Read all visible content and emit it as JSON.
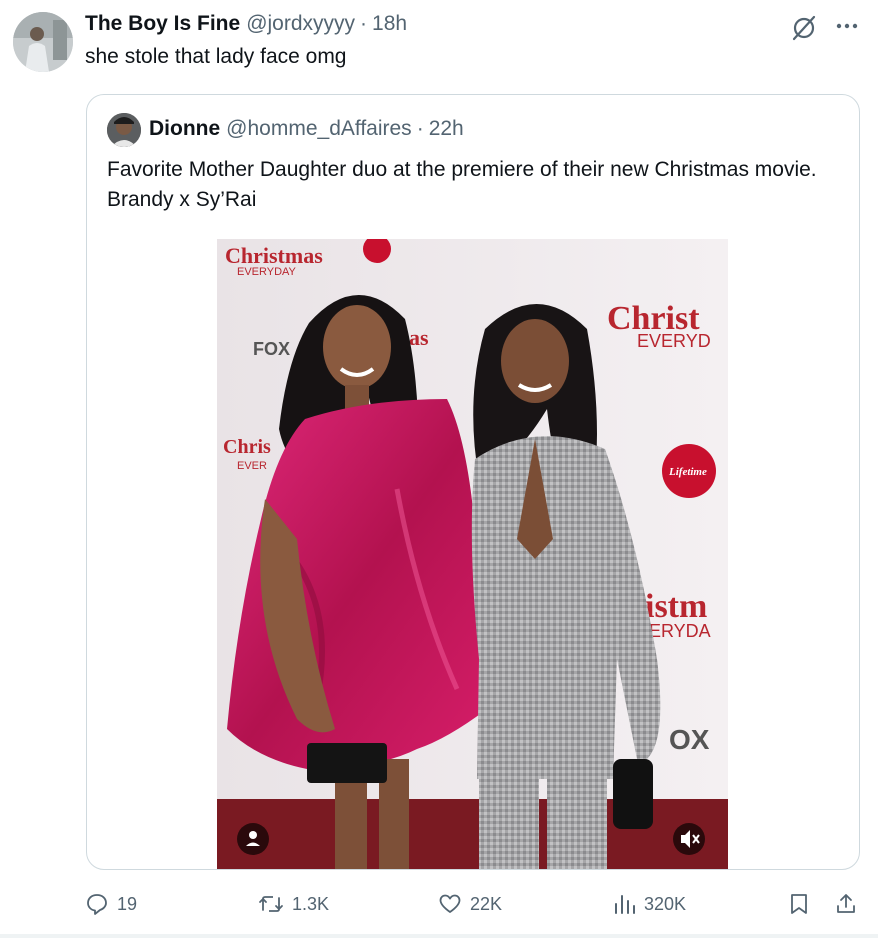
{
  "tweet": {
    "name": "The Boy Is Fine",
    "handle": "@jordxyyyy",
    "separator": "·",
    "time": "18h",
    "text": "she stole that lady face omg"
  },
  "quote": {
    "name": "Dionne",
    "handle": "@homme_dAffaires",
    "separator": "·",
    "time": "22h",
    "text": "Favorite Mother Daughter duo at the premiere of their new Christmas movie. Brandy x Sy’Rai",
    "photo": {
      "backdrop_texts": [
        "Christmas",
        "EVERYDAY",
        "FOX",
        "Chris",
        "EVER",
        "as",
        "Christ",
        "EVERYD",
        "Lifetime",
        "istm",
        "ERYDA",
        "OX"
      ]
    }
  },
  "stats": {
    "replies": "19",
    "reposts": "1.3K",
    "likes": "22K",
    "views": "320K"
  },
  "icons": {
    "grok": "grok-icon",
    "more": "more-icon",
    "reply": "reply-icon",
    "repost": "repost-icon",
    "like": "heart-icon",
    "views": "views-icon",
    "bookmark": "bookmark-icon",
    "share": "share-icon"
  },
  "colors": {
    "text": "#0f1419",
    "secondary": "#536471",
    "border": "#cfd9de",
    "lifetime_red": "#c8102e",
    "dress_pink": "#c0185a"
  }
}
